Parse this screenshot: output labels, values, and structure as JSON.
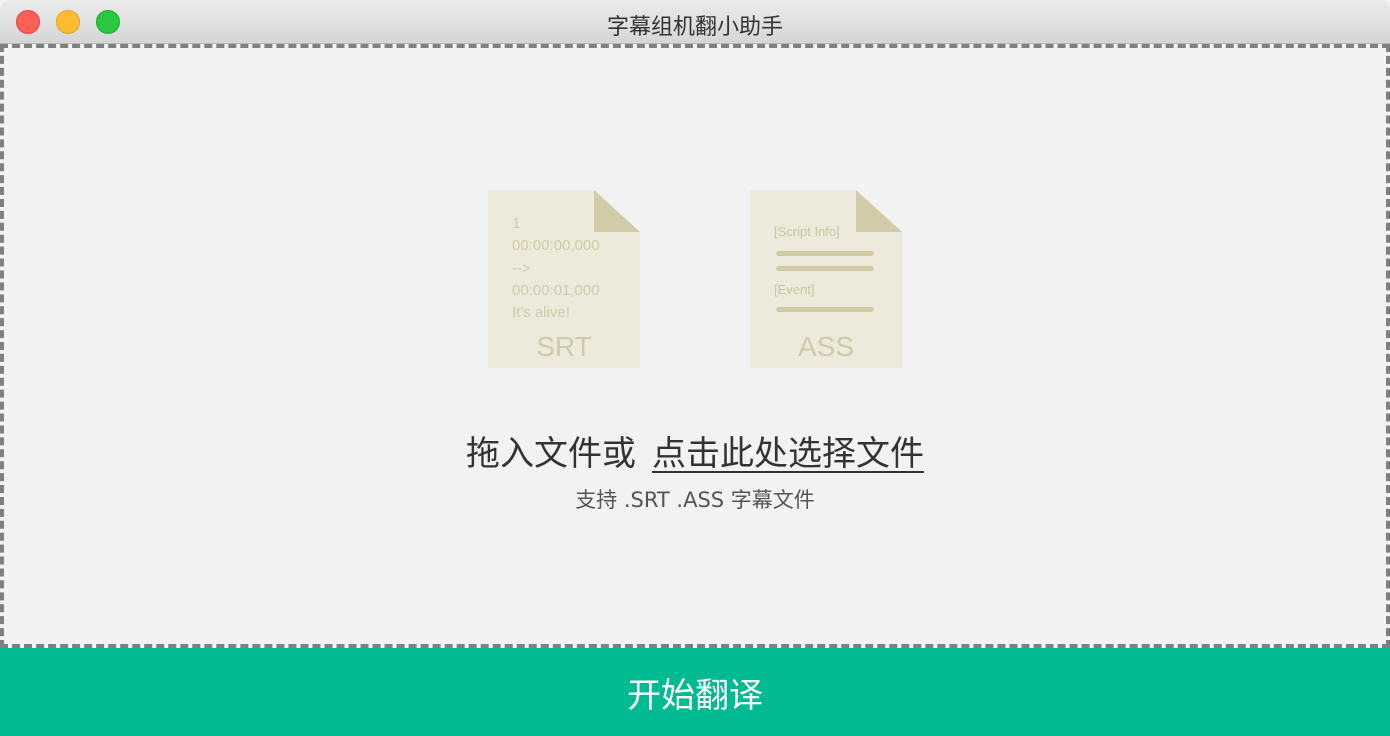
{
  "window": {
    "title": "字幕组机翻小助手"
  },
  "dropzone": {
    "srt_icon": {
      "lines": [
        "1",
        "00:00:00,000",
        "-->",
        "00:00:01,000",
        "It's alive!"
      ],
      "label": "SRT"
    },
    "ass_icon": {
      "section1": "[Script Info]",
      "section2": "[Event]",
      "label": "ASS"
    },
    "prompt_prefix": "拖入文件或",
    "select_link": "点击此处选择文件",
    "hint": "支持 .SRT .ASS 字幕文件"
  },
  "start_button": {
    "label": "开始翻译"
  },
  "colors": {
    "accent": "#00ba92",
    "icon_paper": "#edeadb",
    "icon_fold": "#d2cba7",
    "icon_text": "#d0caa8"
  }
}
